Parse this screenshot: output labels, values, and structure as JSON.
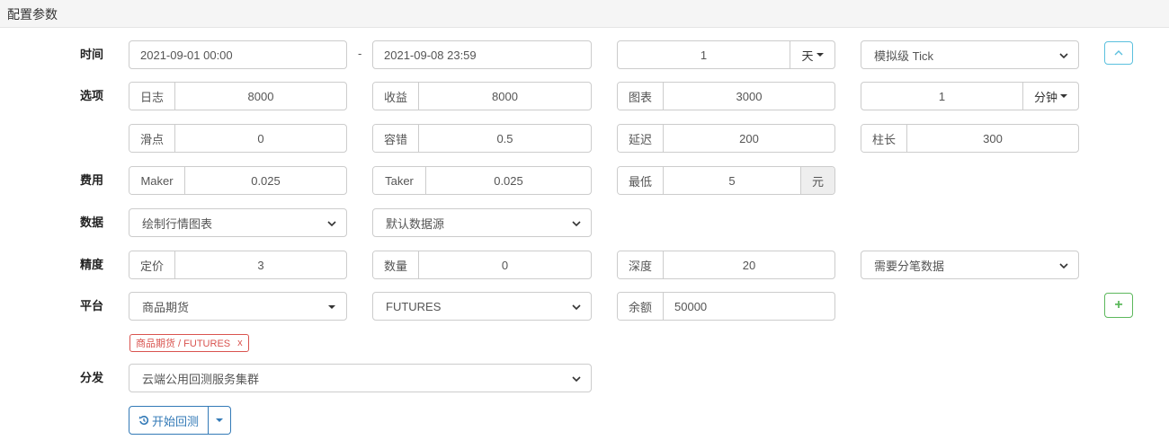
{
  "header": {
    "title": "配置参数"
  },
  "labels": {
    "time": "时间",
    "options": "选项",
    "fee": "费用",
    "data": "数据",
    "precision": "精度",
    "platform": "平台",
    "distribute": "分发"
  },
  "time_row": {
    "start": "2021-09-01 00:00",
    "separator": "-",
    "end": "2021-09-08 23:59",
    "period_value": "1",
    "period_unit": "天",
    "tick_mode": "模拟级 Tick"
  },
  "options_row1": {
    "log_label": "日志",
    "log_value": "8000",
    "profit_label": "收益",
    "profit_value": "8000",
    "chart_label": "图表",
    "chart_value": "3000",
    "kline_value": "1",
    "kline_unit": "分钟"
  },
  "options_row2": {
    "slippage_label": "滑点",
    "slippage_value": "0",
    "tolerance_label": "容错",
    "tolerance_value": "0.5",
    "delay_label": "延迟",
    "delay_value": "200",
    "bar_label": "柱长",
    "bar_value": "300"
  },
  "fee_row": {
    "maker_label": "Maker",
    "maker_value": "0.025",
    "taker_label": "Taker",
    "taker_value": "0.025",
    "min_label": "最低",
    "min_value": "5",
    "min_unit": "元"
  },
  "data_row": {
    "chart_option": "绘制行情图表",
    "source_option": "默认数据源"
  },
  "precision_row": {
    "price_label": "定价",
    "price_value": "3",
    "qty_label": "数量",
    "qty_value": "0",
    "depth_label": "深度",
    "depth_value": "20",
    "tick_data_option": "需要分笔数据"
  },
  "platform_row": {
    "exchange": "商品期货",
    "contract": "FUTURES",
    "balance_label": "余额",
    "balance_value": "50000",
    "add_label": "+"
  },
  "platform_tag": {
    "text": "商品期货 / FUTURES",
    "remove": "x"
  },
  "distribute_row": {
    "cluster": "云端公用回测服务集群"
  },
  "actions": {
    "start_label": "开始回测"
  },
  "colors": {
    "info": "#5bc0de",
    "success": "#5cb85c",
    "danger": "#d9534f",
    "primary": "#337ab7"
  }
}
